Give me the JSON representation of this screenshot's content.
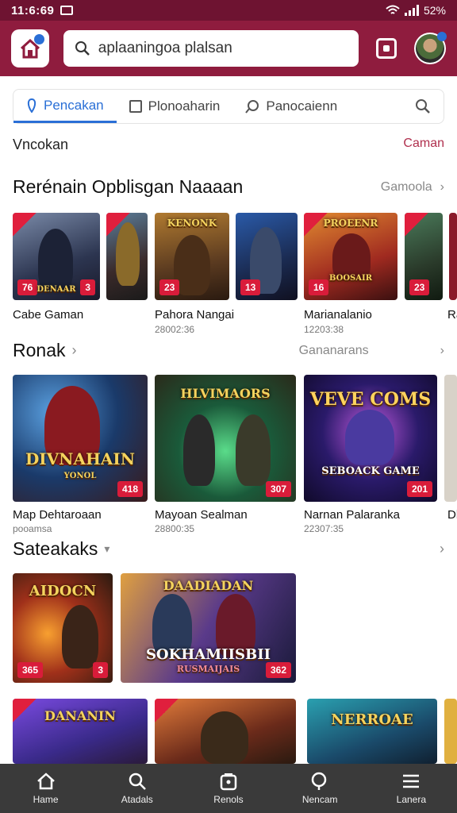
{
  "status": {
    "time": "11:6:69",
    "battery": "52%"
  },
  "search": {
    "value": "aplaaningoa plalsan"
  },
  "tabs": [
    {
      "label": "Pencakan",
      "icon": "tag-icon"
    },
    {
      "label": "Plonoaharin",
      "icon": "box-icon"
    },
    {
      "label": "Panocaienn",
      "icon": "pin-icon"
    }
  ],
  "small_header": {
    "title": "Vncokan",
    "link": "Caman"
  },
  "section1": {
    "title": "Rerénain Opblisgan Naaaan",
    "link": "Gamoola",
    "cards": [
      {
        "badge_left": "76",
        "caption_overlay": "DENAAR",
        "badge_right": "3"
      },
      {
        "badge": ""
      },
      {
        "overlay": "KENONK",
        "badge": "23"
      },
      {
        "badge": "13"
      },
      {
        "overlay": "PROEENR",
        "bottom": "BOOSAIR",
        "badge": "16"
      },
      {
        "badge": "23"
      }
    ],
    "captions": [
      {
        "title": "Cabe Gaman",
        "sub": ""
      },
      {
        "title": "Pahora Nangai",
        "sub": "28002:36"
      },
      {
        "title": "Marianalanio",
        "sub": "12203:38"
      },
      {
        "title": "Ra",
        "sub": ""
      }
    ]
  },
  "section2": {
    "title": "Ronak",
    "link": "Gananarans",
    "cards": [
      {
        "overlay": "DIVNAHAIN",
        "overlay_sub": "YONOL",
        "badge": "418"
      },
      {
        "overlay": "HLVIMAORS",
        "badge": "307"
      },
      {
        "overlay": "VEVE COMS",
        "overlay_sub": "SEBOACK GAME",
        "badge": "201"
      }
    ],
    "captions": [
      {
        "title": "Map Dehtaroaan",
        "sub": "pooamsa"
      },
      {
        "title": "Mayoan Sealman",
        "sub": "28800:35"
      },
      {
        "title": "Narnan Palaranka",
        "sub": "22307:35"
      },
      {
        "title": "Dl",
        "sub": ""
      }
    ]
  },
  "section3": {
    "title": "Sateakaks",
    "cards": [
      {
        "overlay": "AIDOCN",
        "badge_left": "365",
        "badge": "3"
      },
      {
        "overlay": "DAADIADAN",
        "overlay_sub": "SOKHAMIISBII",
        "overlay_sub2": "RUSMAIJAIS",
        "badge": "362"
      }
    ]
  },
  "section4": {
    "cards": [
      {
        "overlay": "DANANIN"
      },
      {
        "overlay": ""
      },
      {
        "overlay": "NERROAE"
      }
    ]
  },
  "bottom_nav": [
    {
      "label": "Hame",
      "icon": "home-icon"
    },
    {
      "label": "Atadals",
      "icon": "search-icon"
    },
    {
      "label": "Renols",
      "icon": "bag-icon"
    },
    {
      "label": "Nencam",
      "icon": "search-icon"
    },
    {
      "label": "Lanera",
      "icon": "menu-icon"
    }
  ],
  "colors": {
    "header": "#8f1c3e",
    "status": "#6e1331",
    "accent": "#2a6fd6",
    "badge": "#d91c3a"
  }
}
